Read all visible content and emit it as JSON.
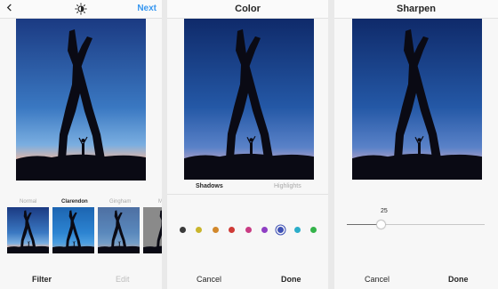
{
  "panel1": {
    "next_label": "Next",
    "filters": [
      "Normal",
      "Clarendon",
      "Gingham",
      "M"
    ],
    "active_filter": "Clarendon",
    "tab_filter": "Filter",
    "tab_edit": "Edit"
  },
  "panel2": {
    "title": "Color",
    "tab_shadows": "Shadows",
    "tab_highlights": "Highlights",
    "colors": [
      "#3a3a3a",
      "#c9b52c",
      "#d2882b",
      "#cf3a36",
      "#c93c83",
      "#8f3fc4",
      "#3f51b5",
      "#2cadc9",
      "#34b34a"
    ],
    "selected_color_index": 6,
    "cancel_label": "Cancel",
    "done_label": "Done"
  },
  "panel3": {
    "title": "Sharpen",
    "slider_value": "25",
    "slider_fraction": 0.25,
    "cancel_label": "Cancel",
    "done_label": "Done"
  },
  "icons": {
    "back": "chevron-left-icon",
    "lux": "lux-sun-icon"
  }
}
